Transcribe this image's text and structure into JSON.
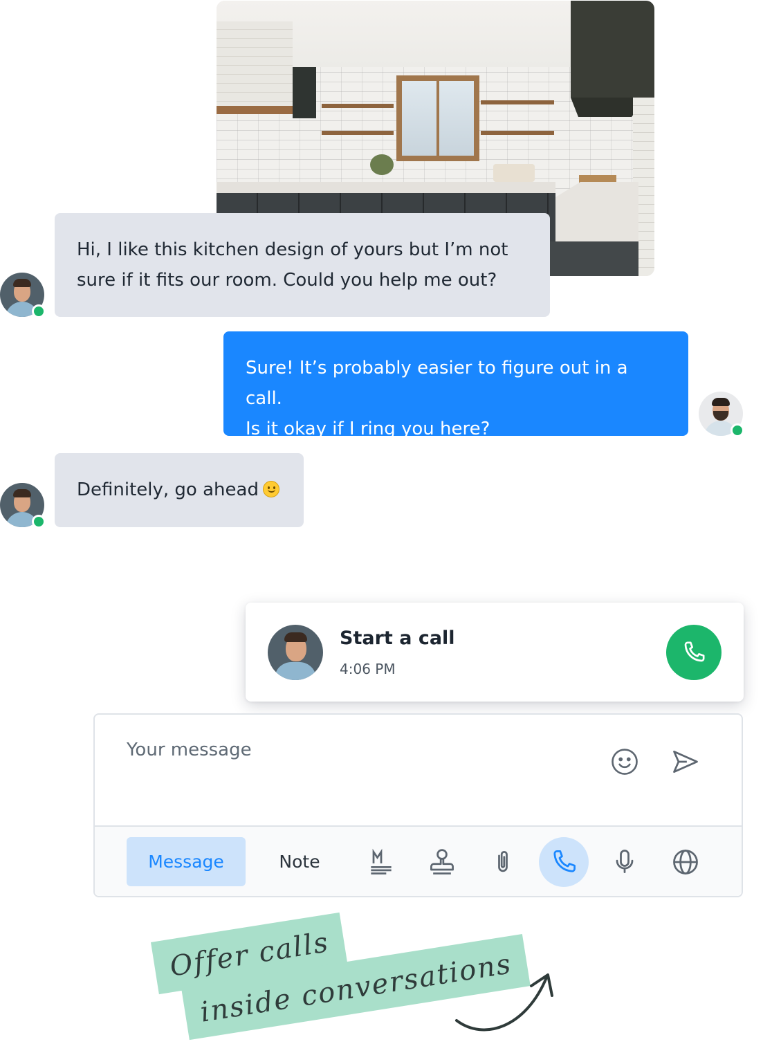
{
  "messages": [
    {
      "from": "customer",
      "text_line1": "Hi, I like this kitchen design of yours but I’m not",
      "text_line2": "sure if it fits our room. Could you help me out?"
    },
    {
      "from": "agent",
      "text_line1": "Sure! It’s probably easier to figure out in a call.",
      "text_line2": "Is it okay if I ring you here?"
    },
    {
      "from": "customer",
      "text": "Definitely, go ahead"
    }
  ],
  "call_card": {
    "title": "Start a call",
    "time": "4:06 PM"
  },
  "composer": {
    "placeholder": "Your message",
    "tabs": {
      "message": "Message",
      "note": "Note"
    }
  },
  "tagline": {
    "line1": "Offer calls",
    "line2": "inside conversations"
  },
  "icons": [
    "emoji-icon",
    "send-icon",
    "markdown-icon",
    "stamp-icon",
    "paperclip-icon",
    "phone-icon",
    "microphone-icon",
    "globe-icon"
  ],
  "colors": {
    "accent": "#1a87ff",
    "online": "#1cb66b",
    "incoming_bubble": "#e1e4eb",
    "tag": "#a9dfca"
  }
}
